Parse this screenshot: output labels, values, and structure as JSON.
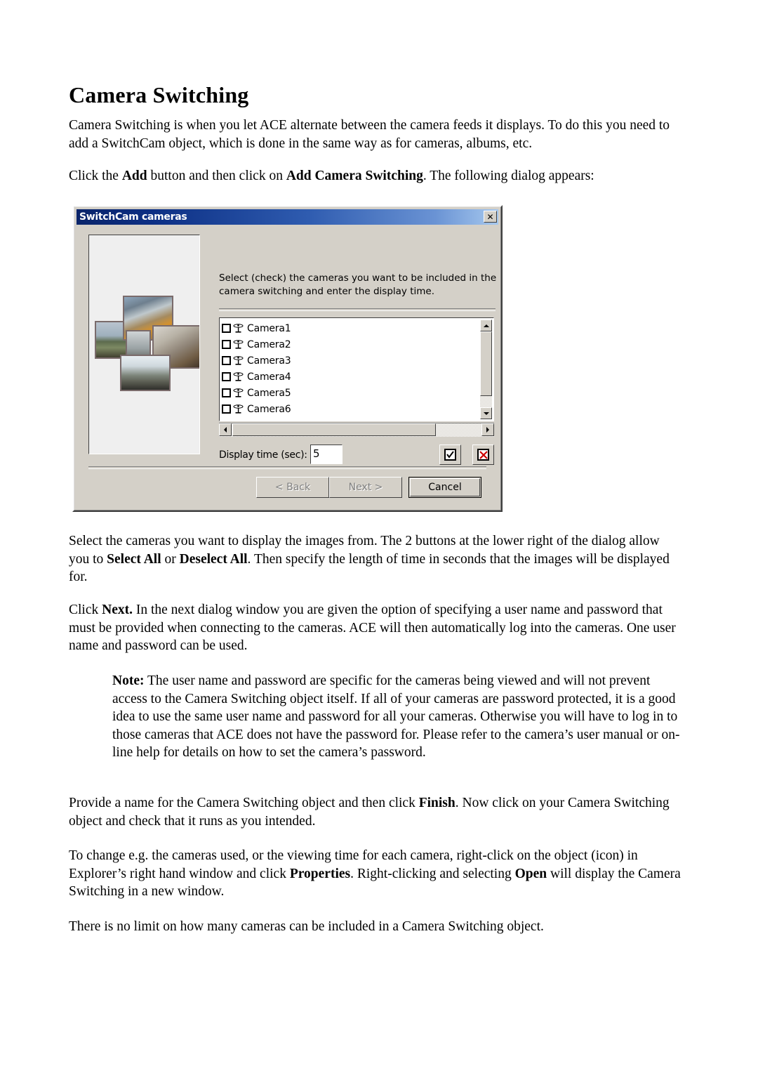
{
  "document": {
    "title": "Camera Switching",
    "paragraphs": [
      {
        "id": "intro",
        "html": "Camera Switching is when you let ACE alternate between the camera feeds it displays. To do this you need to add a SwitchCam object, which is done in the same way as for cameras, albums, etc."
      },
      {
        "id": "click-add",
        "html": "Click the <b>Add</b> button and then click on <b>Add Camera Switching</b>. The following dialog appears:"
      },
      {
        "id": "select-cameras",
        "html": "Select the cameras you want to display the images from. The 2 buttons at the lower right of the dialog allow you to <b>Select All</b> or <b>Deselect All</b>. Then specify the length of time in seconds that the images will be displayed for."
      },
      {
        "id": "click-next",
        "html": "Click <b>Next.</b> In the next dialog window you are given the option of specifying a user name and password that must be provided when connecting to the cameras. ACE will then automatically log into the cameras. One user name and password can be used."
      },
      {
        "id": "note",
        "html": "<b>Note:</b> The user name and password are specific for the cameras being viewed and will not prevent access to the Camera Switching object itself. If all of your cameras are password protected, it is a good idea to use the same user name and password for all your cameras. Otherwise you will have to log in to those cameras that ACE does not have the password for. Please refer to the camera’s user manual or on-line help for details on how to set the camera’s password."
      },
      {
        "id": "provide-name",
        "html": "Provide a name for the Camera Switching object and then click <b>Finish</b>. Now click on your Camera Switching object and check that it runs as you intended."
      },
      {
        "id": "to-change",
        "html": "To change e.g. the cameras used, or the viewing time for each camera, right-click on the object (icon) in Explorer’s right hand window and click <b>Properties</b>. Right-clicking and selecting <b>Open</b> will display the Camera Switching in a new window."
      },
      {
        "id": "no-limit",
        "html": "There is no limit on how many cameras can be included in a Camera Switching object."
      }
    ]
  },
  "dialog": {
    "title": "SwitchCam cameras",
    "close_label": "✕",
    "instruction": "Select (check) the cameras you want to be included in the camera switching and enter the display time.",
    "camera_list": [
      {
        "label": "Camera1",
        "checked": false
      },
      {
        "label": "Camera2",
        "checked": false
      },
      {
        "label": "Camera3",
        "checked": false
      },
      {
        "label": "Camera4",
        "checked": false
      },
      {
        "label": "Camera5",
        "checked": false
      },
      {
        "label": "Camera6",
        "checked": false
      }
    ],
    "display_time": {
      "label": "Display time (sec):",
      "value": "5"
    },
    "select_all_title": "Select All",
    "deselect_all_title": "Deselect All",
    "buttons": {
      "back": "< Back",
      "next": "Next >",
      "cancel": "Cancel"
    },
    "colors": {
      "titlebar_start": "#0a246a",
      "titlebar_end": "#a6c8ee",
      "face": "#d4d0c8",
      "deselect_x": "#cc0000"
    }
  }
}
